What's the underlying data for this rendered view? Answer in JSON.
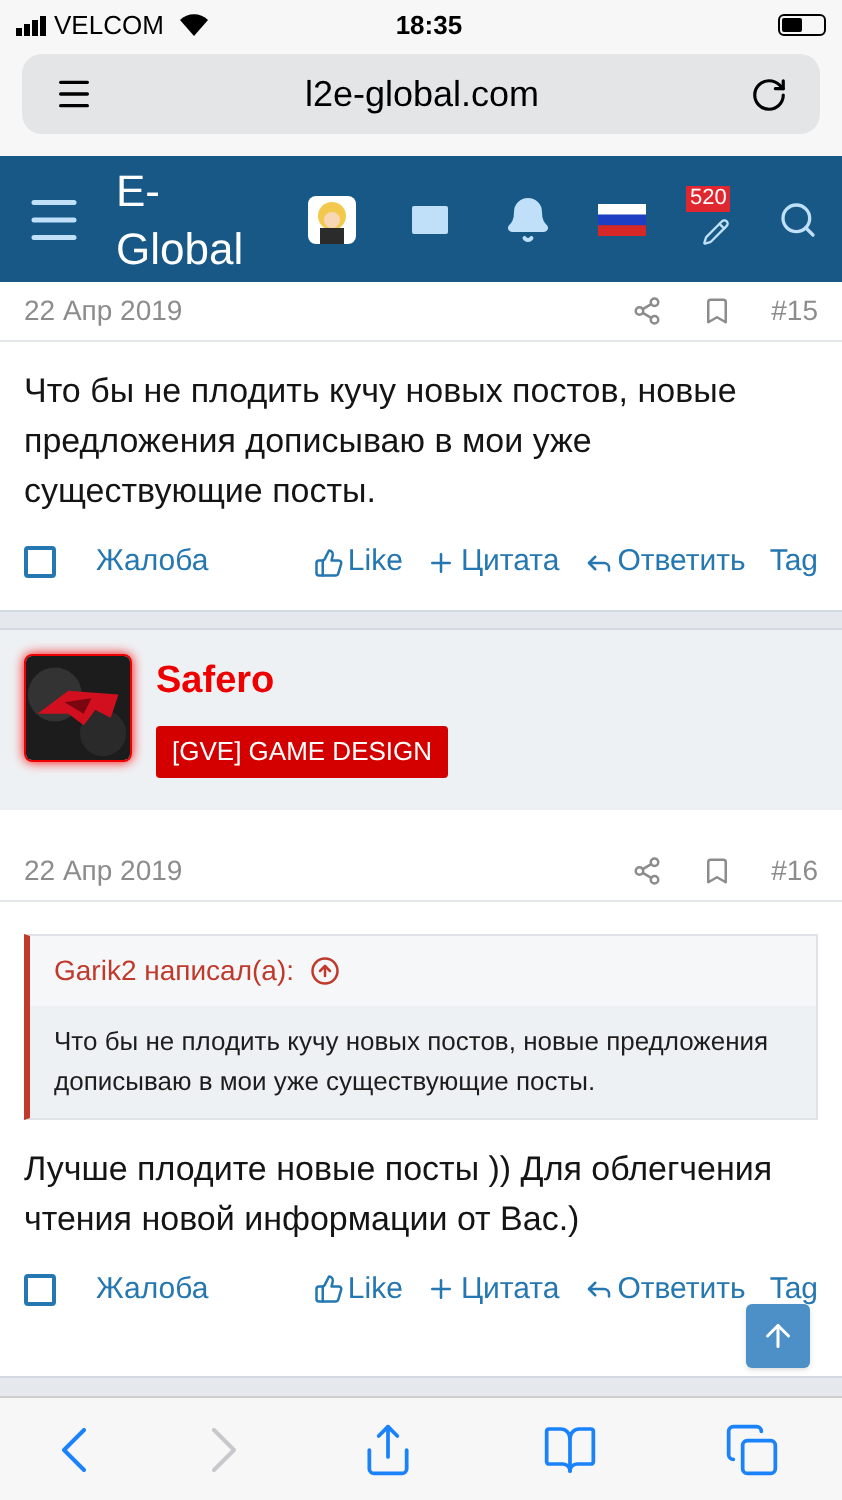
{
  "status_bar": {
    "carrier": "VELCOM",
    "time": "18:35"
  },
  "address_bar": {
    "url": "l2e-global.com"
  },
  "site_header": {
    "logo": "E-\nGlobal",
    "badge_count": "520"
  },
  "posts": [
    {
      "date": "22 Апр 2019",
      "number": "#15",
      "body": "Что бы не плодить кучу новых постов, новые предложения дописываю в мои уже существующие посты.",
      "checked": false,
      "actions": [
        "Жалоба",
        "Like",
        "Цитата",
        "Ответить",
        "Tag"
      ]
    },
    {
      "author": "Safero",
      "user_title": "[GVE] GAME DESIGN",
      "date": "22 Апр 2019",
      "number": "#16",
      "quote": {
        "attribution": "Garik2 написал(а):",
        "text": "Что бы не плодить кучу новых постов, новые предложения дописываю в мои уже существующие посты."
      },
      "body": "Лучше плодите новые посты )) Для облегчения чтения новой информации от Вас.)",
      "checked": false,
      "actions": [
        "Жалоба",
        "Like",
        "Цитата",
        "Ответить",
        "Tag"
      ]
    }
  ],
  "toolbar": [
    {
      "kind": "back",
      "disabled": false
    },
    {
      "kind": "forward",
      "disabled": true
    },
    {
      "kind": "share",
      "disabled": false
    },
    {
      "kind": "bookmarks",
      "disabled": false
    },
    {
      "kind": "tabs",
      "disabled": false
    }
  ]
}
